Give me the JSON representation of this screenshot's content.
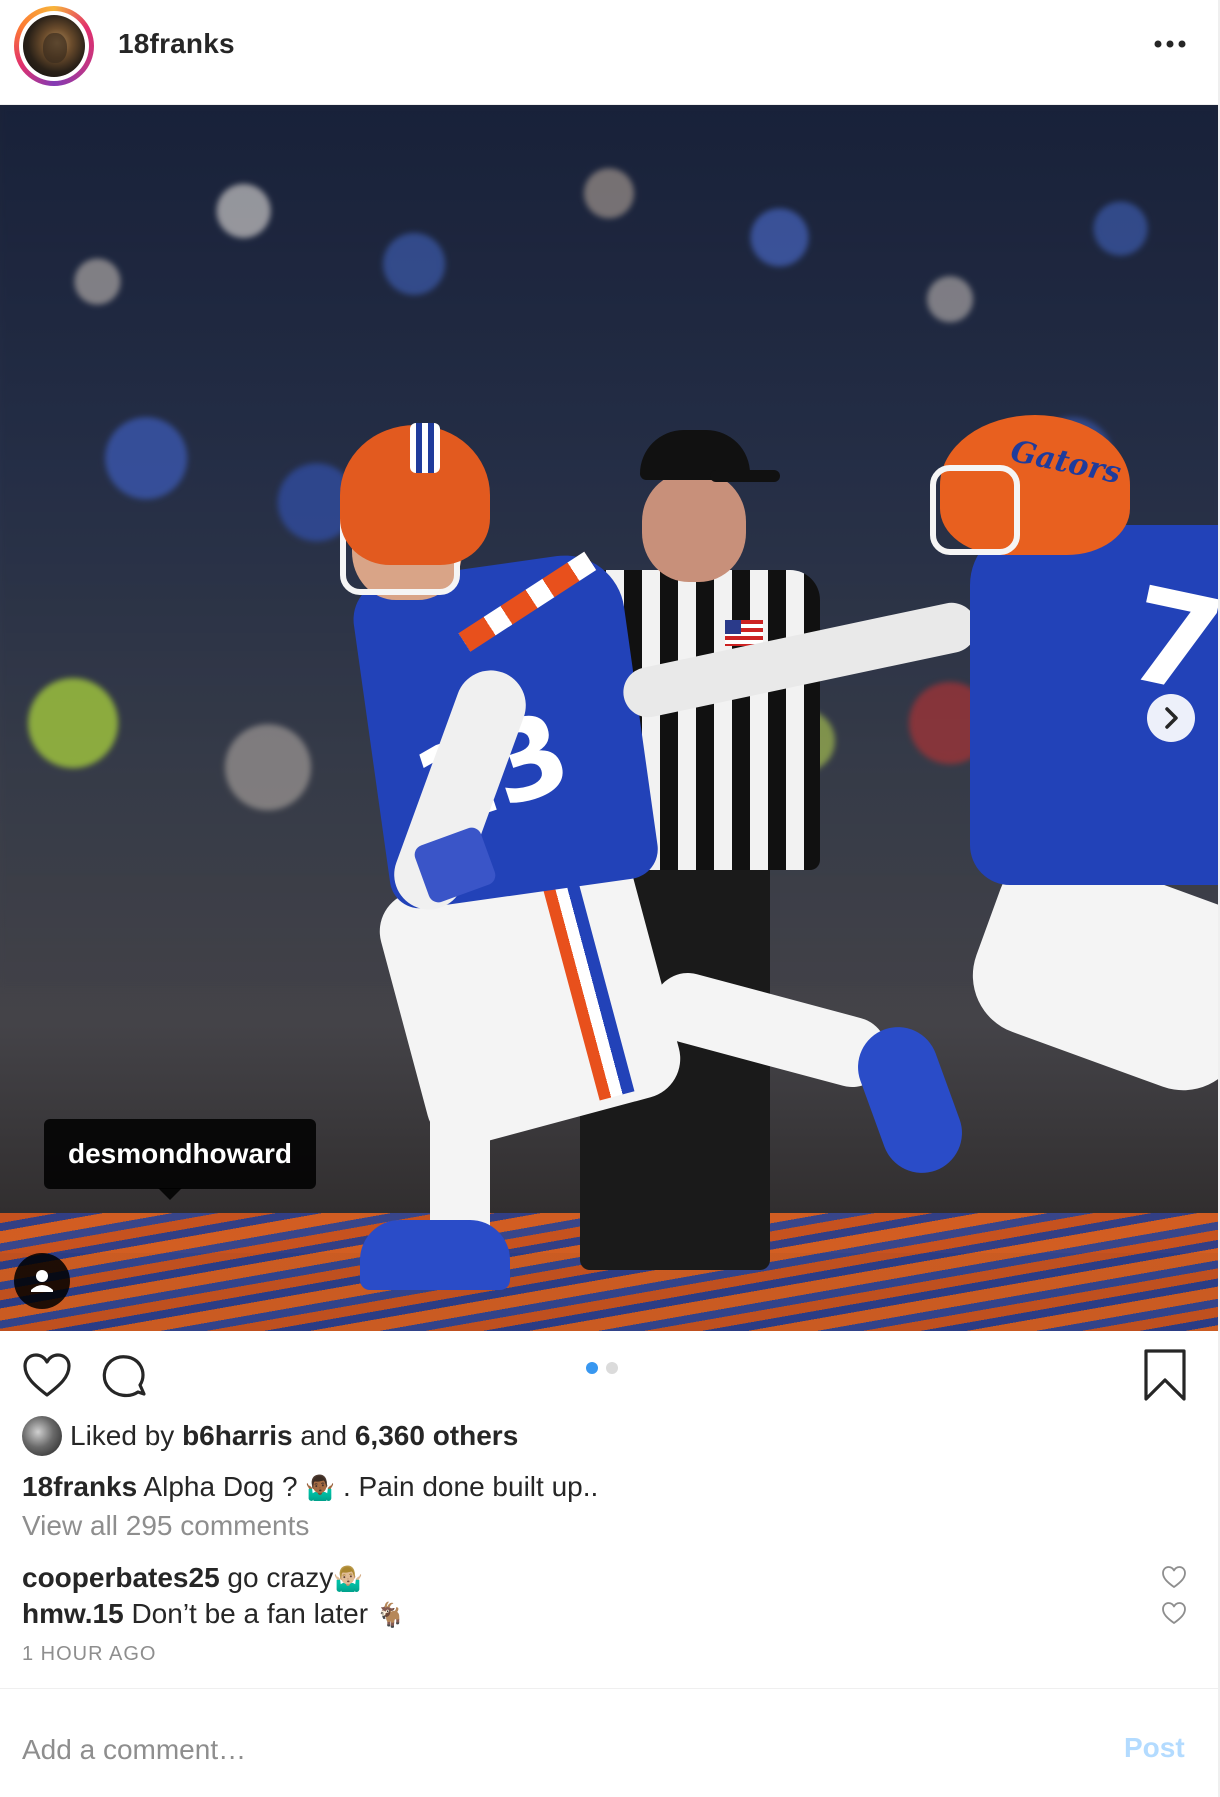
{
  "post": {
    "username": "18franks",
    "more_label": "•••",
    "photo_tag": "desmondhoward",
    "carousel": {
      "count": 2,
      "active_index": 0
    },
    "liked_by_prefix": "Liked by ",
    "liked_by_user": "b6harris",
    "liked_by_middle": " and ",
    "liked_by_count": "6,360 others",
    "caption_user": "18franks",
    "caption_text": " Alpha Dog ? ",
    "caption_emoji": "🤷🏾‍♂️",
    "caption_rest": " . Pain done built up..",
    "view_all_comments": "View all 295 comments",
    "comments": [
      {
        "user": "cooperbates25",
        "text": " go crazy",
        "emoji": "🤷🏼‍♂️"
      },
      {
        "user": "hmw.15",
        "text": " Don’t be a fan later ",
        "emoji": "🐐"
      }
    ],
    "timestamp": "1 HOUR AGO",
    "add_comment_placeholder": "Add a comment…",
    "post_label": "Post"
  },
  "colors": {
    "accent_blue": "#3897f0",
    "post_disabled": "#b3dbff",
    "muted_text": "#8e8e8e",
    "dot_inactive": "#dbdbdb"
  },
  "icons": [
    "more-icon",
    "heart-icon",
    "comment-icon",
    "bookmark-icon",
    "user-tag-icon",
    "chevron-right-icon"
  ]
}
